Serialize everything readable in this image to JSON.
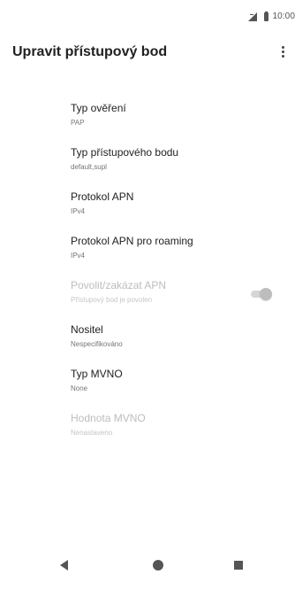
{
  "status_bar": {
    "time": "10:00",
    "icons": [
      "signal-icon",
      "battery-icon"
    ]
  },
  "app_bar": {
    "title": "Upravit přístupový bod",
    "overflow_icon": "overflow-menu-icon"
  },
  "preferences": [
    {
      "title": "Typ ověření",
      "summary": "PAP",
      "enabled": true
    },
    {
      "title": "Typ přístupového bodu",
      "summary": "default,supl",
      "enabled": true
    },
    {
      "title": "Protokol APN",
      "summary": "IPv4",
      "enabled": true
    },
    {
      "title": "Protokol APN pro roaming",
      "summary": "IPv4",
      "enabled": true
    },
    {
      "title": "Povolit/zakázat APN",
      "summary": "Přístupový bod je povolen",
      "enabled": false,
      "switch_on": true
    },
    {
      "title": "Nositel",
      "summary": "Nespecifikováno",
      "enabled": true
    },
    {
      "title": "Typ MVNO",
      "summary": "None",
      "enabled": true
    },
    {
      "title": "Hodnota MVNO",
      "summary": "Nenastaveno",
      "enabled": false
    }
  ],
  "nav_bar": {
    "icons": [
      "back-icon",
      "home-icon",
      "recents-icon"
    ]
  }
}
